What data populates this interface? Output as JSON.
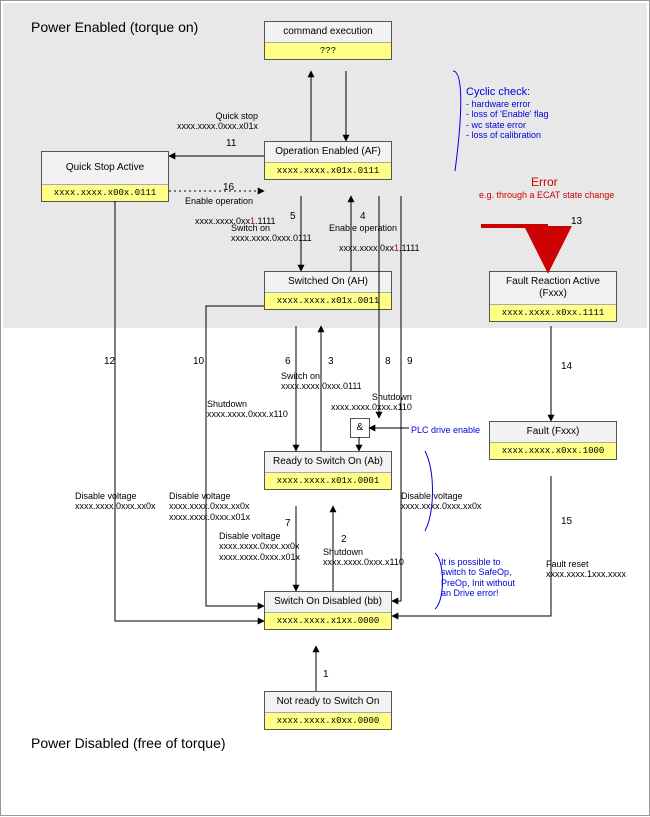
{
  "sections": {
    "power_enabled": "Power\nEnabled\n(torque on)",
    "power_disabled": "Power\nDisabled\n(free of torque)"
  },
  "states": {
    "command_exec": {
      "title": "command execution",
      "code": "???"
    },
    "op_enabled": {
      "title": "Operation Enabled\n(AF)",
      "code": "xxxx.xxxx.x01x.0111"
    },
    "quick_stop": {
      "title": "Quick Stop Active",
      "code": "xxxx.xxxx.x00x.0111"
    },
    "switched_on": {
      "title": "Switched On\n(AH)",
      "code": "xxxx.xxxx.x01x.0011"
    },
    "ready": {
      "title": "Ready to Switch On\n(Ab)",
      "code": "xxxx.xxxx.x01x.0001"
    },
    "sw_disabled": {
      "title": "Switch On Disabled\n(bb)",
      "code": "xxxx.xxxx.x1xx.0000"
    },
    "not_ready": {
      "title": "Not ready to\nSwitch On",
      "code": "xxxx.xxxx.x0xx.0000"
    },
    "fault_react": {
      "title": "Fault Reaction Active\n(Fxxx)",
      "code": "xxxx.xxxx.x0xx.1111"
    },
    "fault": {
      "title": "Fault\n(Fxxx)",
      "code": "xxxx.xxxx.x0xx.1000"
    }
  },
  "edge_labels": {
    "quick_stop": "Quick stop\nxxxx.xxxx.0xxx.x01x",
    "enable_op16": "Enable operation",
    "switch_on5": "Switch on\nxxxx.xxxx.0xxx.0111",
    "enable_op4": "Enable operation",
    "enable_op4_code_pre": "xxxx.xxxx.0xx",
    "enable_op4_code_red": "1",
    "enable_op4_code_post": ".1111",
    "enable_op16_code_pre": "xxxx.xxxx.0xx",
    "enable_op16_code_red": "1",
    "enable_op16_code_post": ".1111",
    "switch_on3": "Switch on\nxxxx.xxxx.0xxx.0111",
    "shutdown6": "Shutdown\nxxxx.xxxx.0xxx.x110",
    "shutdown8": "Shutdown\nxxxx.xxxx.0xxx.x110",
    "disable_v12": "Disable voltage\nxxxx.xxxx.0xxx.xx0x",
    "disable_v10": "Disable voltage\nxxxx.xxxx.0xxx.xx0x\nxxxx.xxxx.0xxx.x01x",
    "disable_v9": "Disable voltage\nxxxx.xxxx.0xxx.xx0x",
    "disable_v7": "Disable voltage\nxxxx.xxxx.0xxx.xx0x\nxxxx.xxxx.0xxx.x01x",
    "shutdown2": "Shutdown\nxxxx.xxxx.0xxx.x110",
    "fault_reset": "Fault reset\nxxxx.xxxx.1xxx.xxxx",
    "plc": "PLC drive enable"
  },
  "edge_nums": {
    "n1": "1",
    "n2": "2",
    "n3": "3",
    "n4": "4",
    "n5": "5",
    "n6": "6",
    "n7": "7",
    "n8": "8",
    "n9": "9",
    "n10": "10",
    "n11": "11",
    "n12": "12",
    "n13": "13",
    "n14": "14",
    "n15": "15",
    "n16": "16"
  },
  "notes": {
    "cyclic_head": "Cyclic check:",
    "cyclic_body": "- hardware error\n- loss of 'Enable' flag\n- wc state error\n- loss of calibration",
    "error_head": "Error",
    "error_body": "e.g. through a ECAT state change",
    "switch_note": "It is possible to\nswitch to SafeOp,\nPreOp, Init without\nan Drive error!"
  },
  "amp": "&"
}
